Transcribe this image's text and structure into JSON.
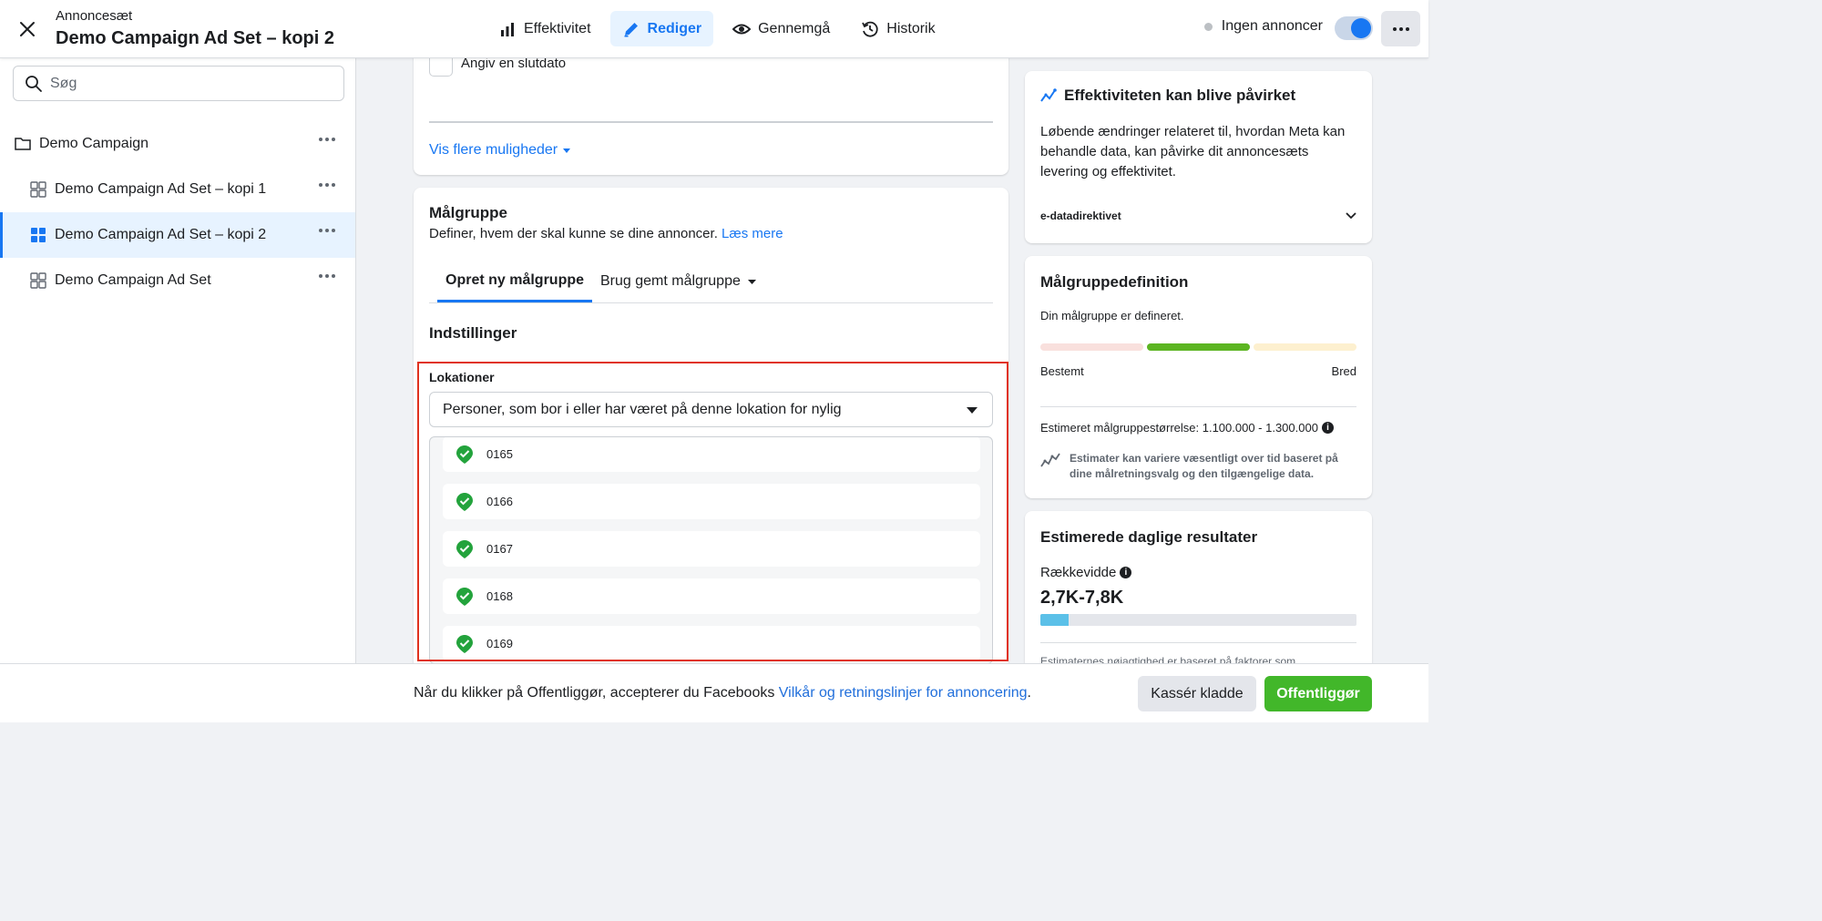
{
  "header": {
    "subtitle": "Annoncesæt",
    "title": "Demo Campaign Ad Set – kopi 2",
    "tabs": [
      {
        "label": "Effektivitet",
        "icon": "bar-chart-icon",
        "active": false
      },
      {
        "label": "Rediger",
        "icon": "pencil-icon",
        "active": true
      },
      {
        "label": "Gennemgå",
        "icon": "eye-icon",
        "active": false
      },
      {
        "label": "Historik",
        "icon": "history-icon",
        "active": false
      }
    ],
    "status_label": "Ingen annoncer",
    "toggle_on": true
  },
  "sidebar": {
    "search_placeholder": "Søg",
    "items": [
      {
        "label": "Demo Campaign",
        "icon": "folder-icon",
        "level": 0,
        "selected": false
      },
      {
        "label": "Demo Campaign Ad Set – kopi 1",
        "icon": "grid-icon",
        "level": 1,
        "selected": false
      },
      {
        "label": "Demo Campaign Ad Set – kopi 2",
        "icon": "grid-icon",
        "level": 1,
        "selected": true
      },
      {
        "label": "Demo Campaign Ad Set",
        "icon": "grid-icon",
        "level": 1,
        "selected": false
      }
    ]
  },
  "schedule": {
    "end_date_label": "Angiv en slutdato",
    "more_options": "Vis flere muligheder"
  },
  "audience": {
    "title": "Målgruppe",
    "description": "Definer, hvem der skal kunne se dine annoncer.",
    "learn_more": "Læs mere",
    "tabs": [
      "Opret ny målgruppe",
      "Brug gemt målgruppe"
    ],
    "settings_title": "Indstillinger",
    "locations_label": "Lokationer",
    "locations_select": "Personer, som bor i eller har været på denne lokation for nylig",
    "locations": [
      "0165",
      "0166",
      "0167",
      "0168",
      "0169"
    ]
  },
  "right": {
    "notice": {
      "title": "Effektiviteten kan blive påvirket",
      "body": "Løbende ændringer relateret til, hvordan Meta kan behandle data, kan påvirke dit annoncesæts levering og effektivitet.",
      "directive": "e-datadirektivet"
    },
    "definition": {
      "title": "Målgruppedefinition",
      "status": "Din målgruppe er defineret.",
      "left_label": "Bestemt",
      "right_label": "Bred",
      "estimate_label": "Estimeret målgruppestørrelse: 1.100.000 - 1.300.000",
      "note": "Estimater kan variere væsentligt over tid baseret på dine målretningsvalg og den tilgængelige data."
    },
    "daily": {
      "title": "Estimerede daglige resultater",
      "reach_label": "Rækkevidde",
      "reach_value": "2,7K-7,8K",
      "reach_fill": 0.09,
      "cut_text": "Estimaternes nøjagtighed er baseret på faktorer som"
    }
  },
  "footer": {
    "text": "Når du klikker på Offentliggør, accepterer du Facebooks",
    "link": "Vilkår og retningslinjer for annoncering",
    "period": ".",
    "discard": "Kassér kladde",
    "publish": "Offentliggør"
  },
  "colors": {
    "accent": "#1877f2",
    "publish": "#42b72a",
    "highlight": "#e0321e",
    "meter_narrow": "#f9e0dd",
    "meter_good": "#5cb521",
    "meter_broad": "#fdf0cf",
    "reach_fill": "#5bc0e8",
    "pin": "#23a33c"
  }
}
